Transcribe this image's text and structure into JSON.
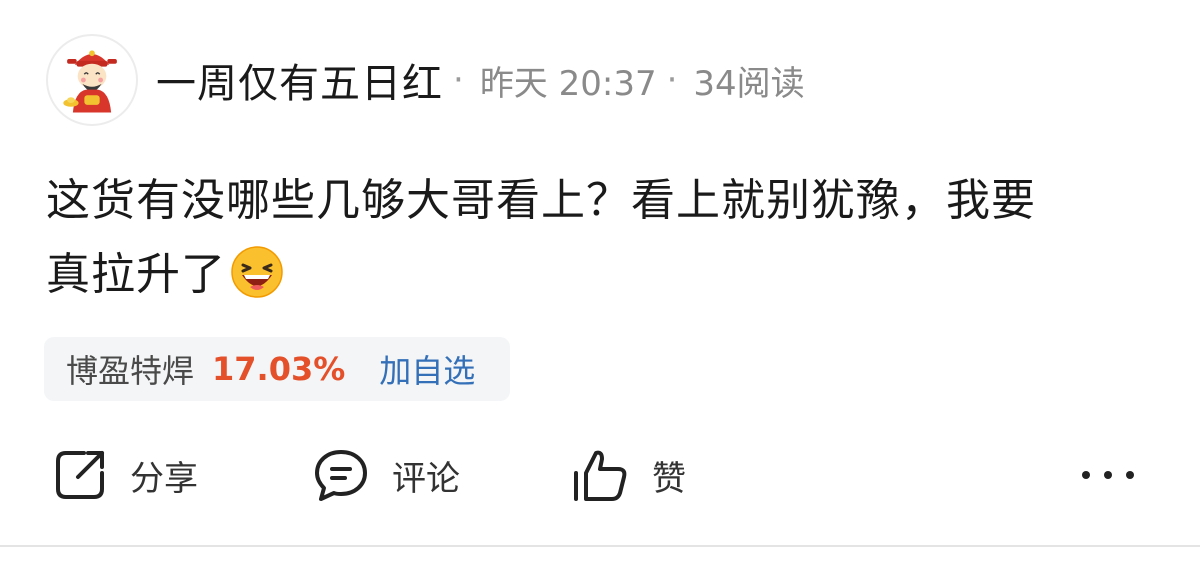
{
  "author": {
    "name": "一周仅有五日红",
    "separator": "·",
    "time": "昨天 20:37",
    "reads": "34阅读",
    "avatar_icon": "caishen-avatar-icon"
  },
  "post": {
    "text": "这货有没哪些几够大哥看上？看上就别犹豫，我要真拉升了",
    "emoji": "laughing-emoji-icon"
  },
  "stock": {
    "name": "博盈特焊",
    "change": "17.03%",
    "add_label": "加自选",
    "change_color": "#e4502a",
    "link_color": "#3470b8"
  },
  "actions": {
    "share_label": "分享",
    "comment_label": "评论",
    "like_label": "赞",
    "share_icon": "share-icon",
    "comment_icon": "comment-icon",
    "like_icon": "thumbs-up-icon",
    "more_icon": "more-dots-icon"
  }
}
